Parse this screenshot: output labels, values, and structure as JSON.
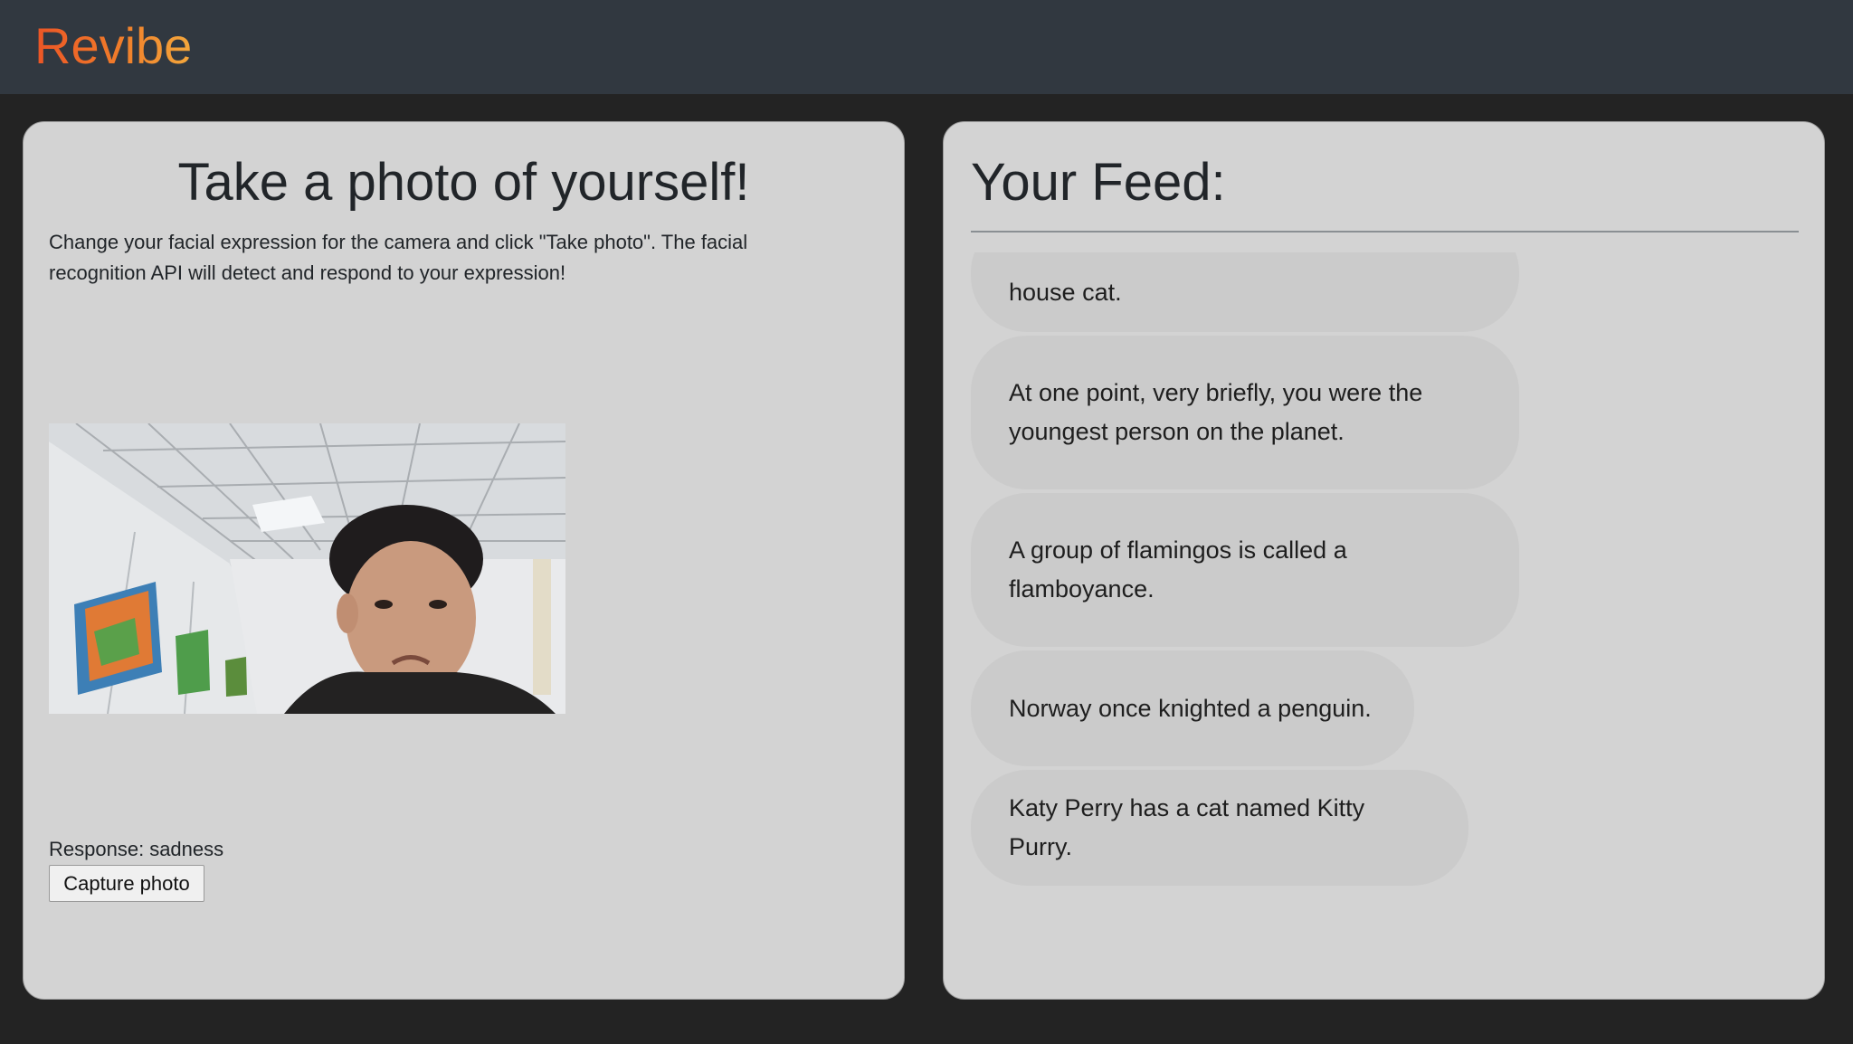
{
  "app": {
    "brand": "Revibe"
  },
  "capture": {
    "title": "Take a photo of yourself!",
    "description": "Change your facial expression for the camera and click \"Take photo\". The facial recognition API will detect and respond to your expression!",
    "response_label": "Response:",
    "response_value": "sadness",
    "button_label": "Capture photo"
  },
  "feed": {
    "title": "Your Feed:",
    "items": [
      "house cat.",
      "At one point, very briefly, you were the youngest person on the planet.",
      "A group of flamingos is called a flamboyance.",
      "Norway once knighted a penguin.",
      "Katy Perry has a cat named Kitty Purry."
    ]
  },
  "colors": {
    "brand_gradient_start": "#ec5526",
    "brand_gradient_end": "#f4a83c",
    "navbar": "#313840",
    "page_background": "#232323",
    "card_background": "#d3d3d3",
    "bubble_background": "#cbcbcb"
  }
}
